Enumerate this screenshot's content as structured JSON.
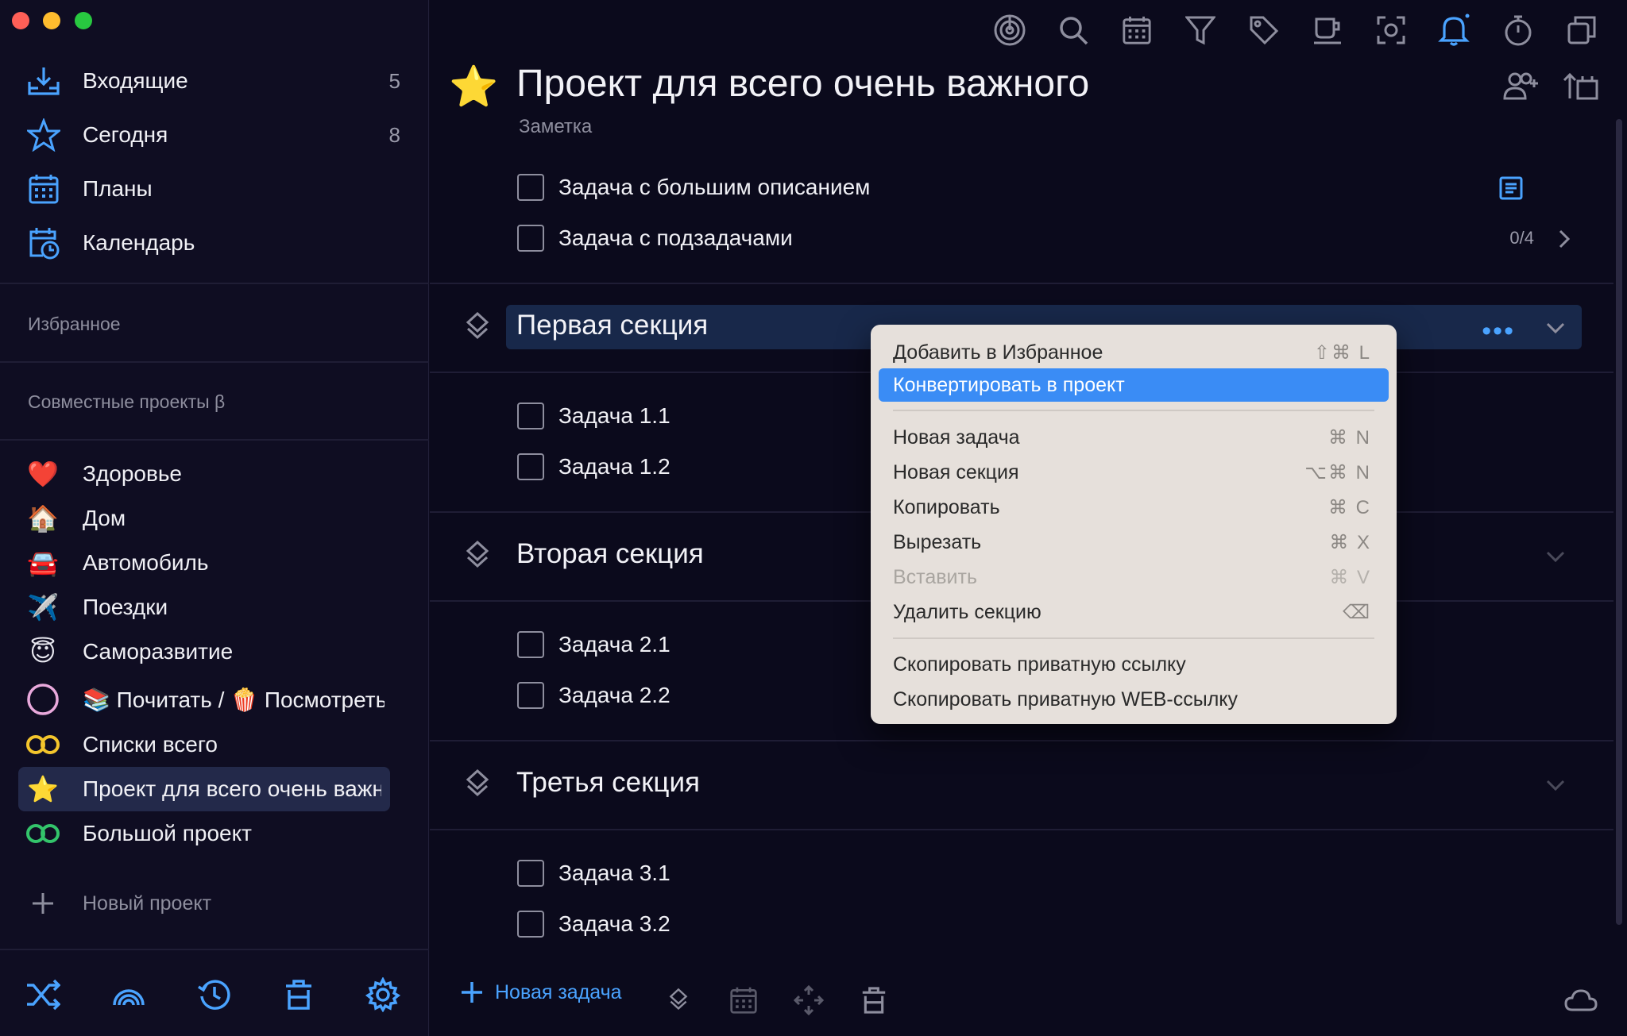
{
  "sidebar": {
    "nav": [
      {
        "label": "Входящие",
        "count": "5",
        "icon": "inbox-icon"
      },
      {
        "label": "Сегодня",
        "count": "8",
        "icon": "star-outline-icon"
      },
      {
        "label": "Планы",
        "count": "",
        "icon": "calendar-grid-icon"
      },
      {
        "label": "Календарь",
        "count": "",
        "icon": "calendar-clock-icon"
      }
    ],
    "favorites_heading": "Избранное",
    "shared_heading": "Совместные проекты β",
    "projects": [
      {
        "label": "Здоровье",
        "icon": "heart-icon",
        "glyph": "❤️"
      },
      {
        "label": "Дом",
        "icon": "house-icon",
        "glyph": "🏠"
      },
      {
        "label": "Автомобиль",
        "icon": "car-icon",
        "glyph": "🚘"
      },
      {
        "label": "Поездки",
        "icon": "airplane-icon",
        "glyph": "✈️"
      },
      {
        "label": "Саморазвитие",
        "icon": "halo-smile-icon",
        "glyph": "😇"
      },
      {
        "label": "📚 Почитать / 🍿 Посмотреть",
        "icon": "circle-icon",
        "glyph": ""
      },
      {
        "label": "Списки всего",
        "icon": "double-ring-yellow-icon",
        "glyph": ""
      },
      {
        "label": "Проект для всего очень важного",
        "icon": "star-icon",
        "glyph": "⭐"
      },
      {
        "label": "Большой проект",
        "icon": "double-ring-green-icon",
        "glyph": ""
      }
    ],
    "new_project": "Новый проект"
  },
  "main": {
    "title": "Проект для всего очень важного",
    "note": "Заметка",
    "top_tasks": [
      {
        "label": "Задача с большим описанием",
        "meta": ""
      },
      {
        "label": "Задача с подзадачами",
        "meta": "0/4"
      }
    ],
    "sections": [
      {
        "title": "Первая секция",
        "tasks": [
          "Задача 1.1",
          "Задача 1.2"
        ]
      },
      {
        "title": "Вторая секция",
        "tasks": [
          "Задача 2.1",
          "Задача 2.2"
        ]
      },
      {
        "title": "Третья секция",
        "tasks": [
          "Задача 3.1",
          "Задача 3.2"
        ]
      }
    ],
    "new_task": "Новая задача"
  },
  "context_menu": {
    "items": [
      {
        "label": "Добавить в Избранное",
        "shortcut": "⇧⌘ L",
        "state": "normal"
      },
      {
        "label": "Конвертировать в проект",
        "shortcut": "",
        "state": "highlighted"
      },
      {
        "label": "Новая задача",
        "shortcut": "⌘ N",
        "state": "normal"
      },
      {
        "label": "Новая секция",
        "shortcut": "⌥⌘ N",
        "state": "normal"
      },
      {
        "label": "Копировать",
        "shortcut": "⌘ C",
        "state": "normal"
      },
      {
        "label": "Вырезать",
        "shortcut": "⌘ X",
        "state": "normal"
      },
      {
        "label": "Вставить",
        "shortcut": "⌘ V",
        "state": "disabled"
      },
      {
        "label": "Удалить секцию",
        "shortcut": "⌫",
        "state": "normal"
      },
      {
        "label": "Скопировать приватную ссылку",
        "shortcut": "",
        "state": "normal"
      },
      {
        "label": "Скопировать приватную WEB-ссылку",
        "shortcut": "",
        "state": "normal"
      }
    ]
  },
  "colors": {
    "accent": "#4aa3ff",
    "menu_bg": "#e6e0db",
    "highlight": "#3a8cf5",
    "section_bg": "#18284a"
  }
}
